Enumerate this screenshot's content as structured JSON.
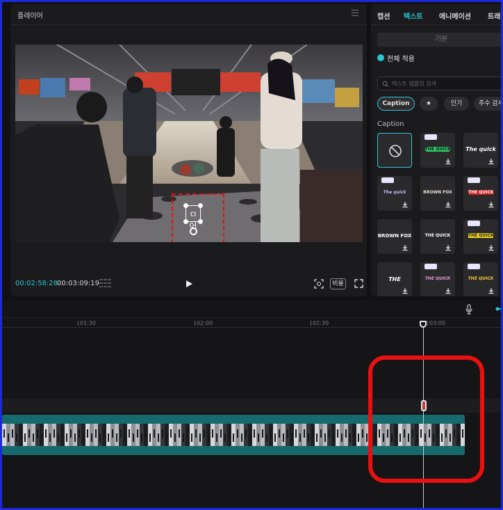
{
  "player": {
    "title": "플레이어",
    "timecode_current": "00:02:58:28",
    "timecode_total": "00:03:09:19",
    "ratio_label": "비율",
    "overlay_text": "ㅁ어"
  },
  "panel": {
    "tabs": [
      "캡션",
      "텍스트",
      "애니메이션",
      "트래킹"
    ],
    "active_tab": "텍스트",
    "preset_label": "기본",
    "apply_all_label": "전체 적용",
    "search_placeholder": "텍스트 템플릿 검색",
    "chips": [
      "Caption",
      "★",
      "인기",
      "추수 감사"
    ],
    "section_label": "Caption",
    "templates": [
      {
        "text": "",
        "pro": false,
        "style": "none"
      },
      {
        "text": "THE QUICK",
        "pro": true,
        "style": "green"
      },
      {
        "text": "The quick",
        "pro": false,
        "style": "white-italic"
      },
      {
        "text": "The quick",
        "pro": true,
        "style": "purple"
      },
      {
        "text": "BROWN FOX",
        "pro": false,
        "style": "outline"
      },
      {
        "text": "THE QUICK",
        "pro": true,
        "style": "red"
      },
      {
        "text": "BROWN FOX",
        "pro": false,
        "style": "white-bold"
      },
      {
        "text": "THE QUICK",
        "pro": false,
        "style": "white"
      },
      {
        "text": "THE QUICK",
        "pro": true,
        "style": "yellow"
      },
      {
        "text": "THE",
        "pro": false,
        "style": "white-big"
      },
      {
        "text": "THE QUICK",
        "pro": true,
        "style": "pink-italic"
      },
      {
        "text": "THE QUICK",
        "pro": true,
        "style": "gold-italic"
      }
    ]
  },
  "timeline": {
    "ruler_ticks": [
      "01:30",
      "02:00",
      "02:30",
      "03:00"
    ]
  },
  "colors": {
    "accent": "#2bc4d6",
    "clip": "#0f5e62",
    "highlight": "#e81010",
    "selection_box": "#e81010"
  }
}
